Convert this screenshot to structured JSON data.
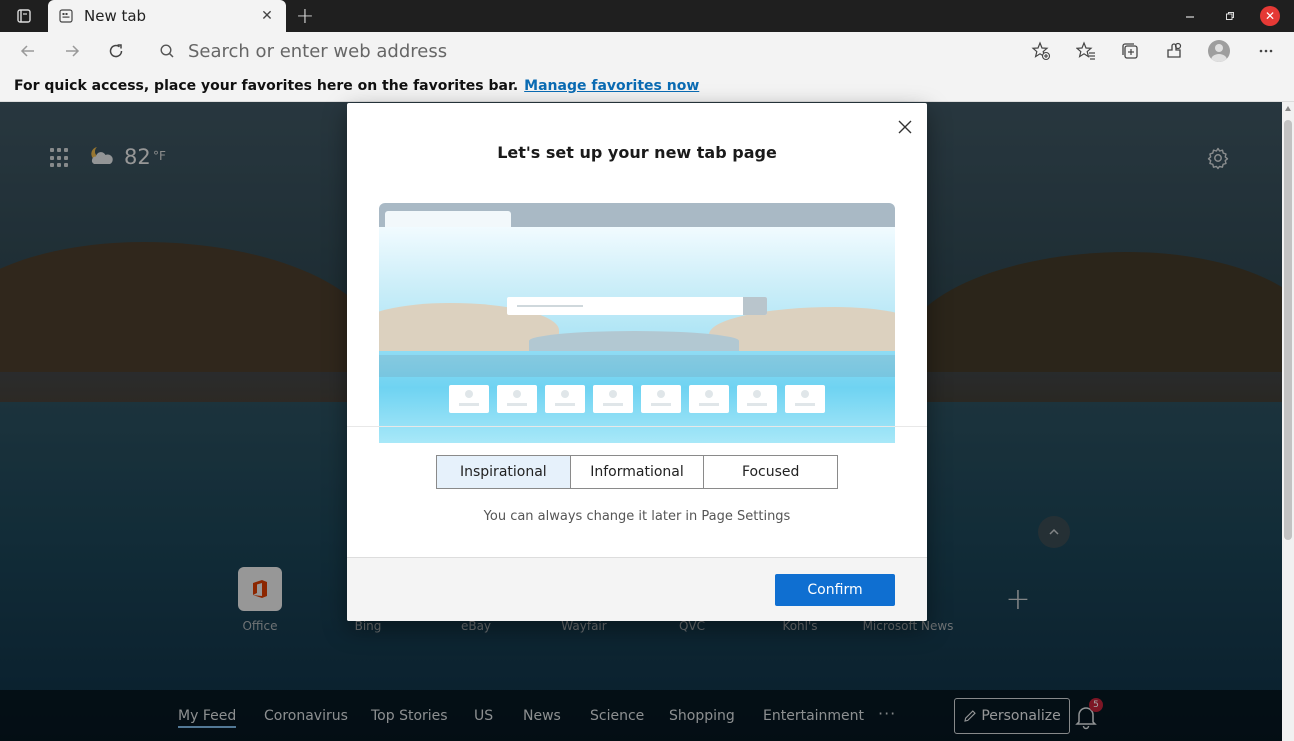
{
  "tab": {
    "title": "New tab"
  },
  "toolbar": {
    "address_placeholder": "Search or enter web address"
  },
  "favbar": {
    "text": "For quick access, place your favorites here on the favorites bar.",
    "link": "Manage favorites now"
  },
  "weather": {
    "temp": "82",
    "unit": "°F"
  },
  "quicklinks": [
    {
      "label": "Office"
    },
    {
      "label": "Bing"
    },
    {
      "label": "eBay"
    },
    {
      "label": "Wayfair"
    },
    {
      "label": "QVC"
    },
    {
      "label": "Kohl's"
    },
    {
      "label": "Microsoft News"
    }
  ],
  "feed": {
    "tabs": [
      "My Feed",
      "Coronavirus",
      "Top Stories",
      "US",
      "News",
      "Science",
      "Shopping",
      "Entertainment"
    ],
    "more": "···",
    "personalize_label": "Personalize",
    "notification_count": "5"
  },
  "modal": {
    "title": "Let's set up your new tab page",
    "options": [
      "Inspirational",
      "Informational",
      "Focused"
    ],
    "selected_option": "Inspirational",
    "hint": "You can always change it later in Page Settings",
    "confirm_label": "Confirm"
  },
  "colors": {
    "accent": "#0f6fd1",
    "link": "#0a6bb3",
    "close_button": "#e53935",
    "badge": "#c0223a"
  }
}
